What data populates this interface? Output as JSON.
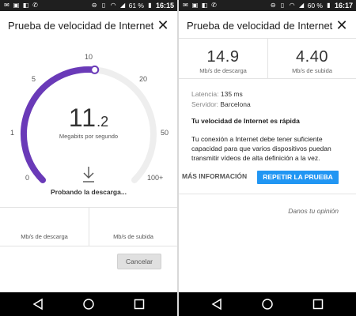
{
  "colors": {
    "accent": "#6a3ab8",
    "track": "#eeeeee",
    "button_blue": "#2196f3",
    "status_bar": "#1f1f1f",
    "nav_bar": "#000000"
  },
  "left": {
    "status": {
      "battery": "61 %",
      "time": "16:15"
    },
    "title": "Prueba de velocidad de Internet",
    "close_icon": "close-icon",
    "gauge": {
      "scale_labels": [
        "0",
        "1",
        "5",
        "10",
        "20",
        "50",
        "100+"
      ],
      "value_main": "11",
      "value_decimal": ".2",
      "unit": "Megabits por segundo",
      "progress": 0.52
    },
    "status_text": "Probando la descarga...",
    "download_label": "Mb/s de descarga",
    "upload_label": "Mb/s de subida",
    "cancel_label": "Cancelar"
  },
  "right": {
    "status": {
      "battery": "60 %",
      "time": "16:17"
    },
    "title": "Prueba de velocidad de Internet",
    "download_value": "14.9",
    "download_label": "Mb/s de descarga",
    "upload_value": "4.40",
    "upload_label": "Mb/s de subida",
    "latency_label": "Latencia:",
    "latency_value": "135 ms",
    "server_label": "Servidor:",
    "server_value": "Barcelona",
    "fast_title": "Tu velocidad de Internet es rápida",
    "description": "Tu conexión a Internet debe tener suficiente capacidad para que varios dispositivos puedan transmitir vídeos de alta definición a la vez.",
    "more_info_label": "MÁS INFORMACIÓN",
    "repeat_label": "REPETIR LA PRUEBA",
    "feedback_label": "Danos tu opinión"
  }
}
